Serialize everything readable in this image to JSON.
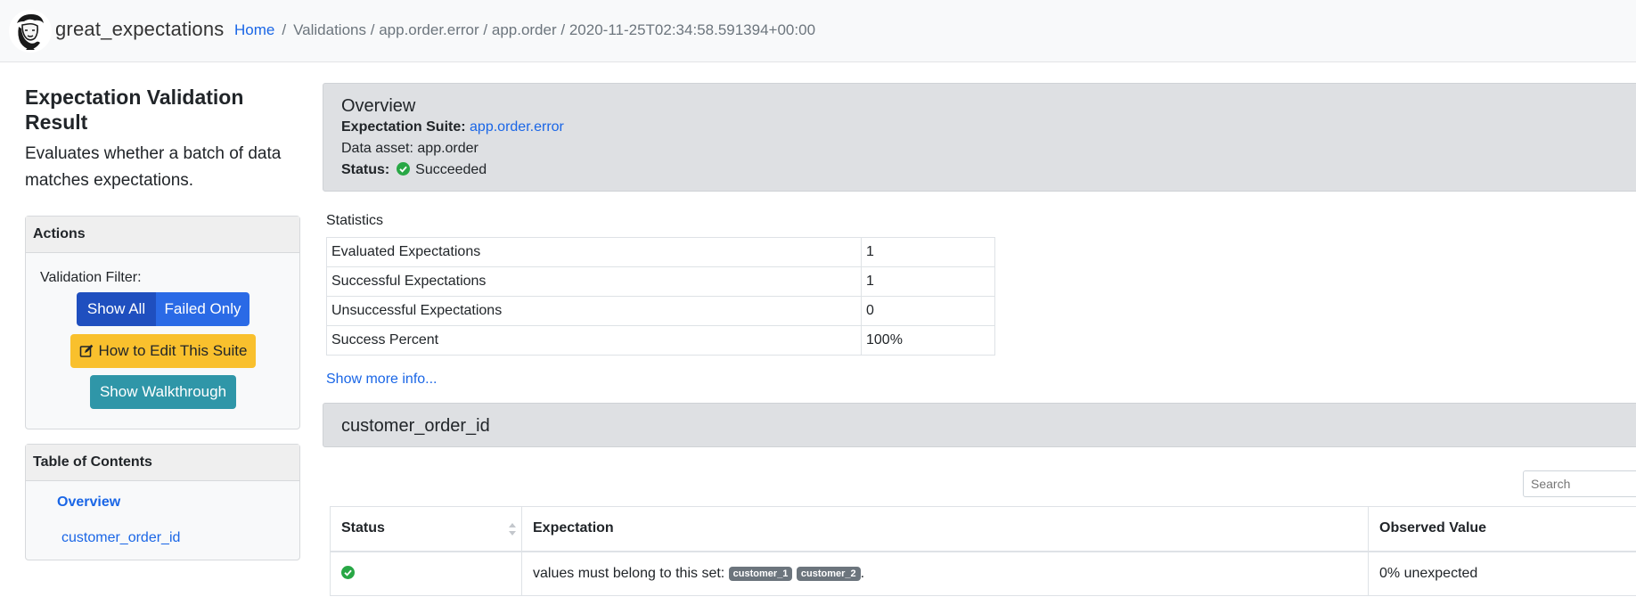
{
  "navbar": {
    "brand": "great_expectations",
    "breadcrumb": {
      "home": "Home",
      "sep": "/",
      "validations": "Validations",
      "suite": "app.order.error",
      "asset": "app.order",
      "run": "2020-11-25T02:34:58.591394+00:00"
    }
  },
  "sidebar": {
    "title": "Expectation Validation Result",
    "description": "Evaluates whether a batch of data matches expectations.",
    "actions": {
      "header": "Actions",
      "filter_label": "Validation Filter:",
      "show_all": "Show All",
      "failed_only": "Failed Only",
      "edit_suite": "How to Edit This Suite",
      "walkthrough": "Show Walkthrough"
    },
    "toc": {
      "header": "Table of Contents",
      "items": [
        "Overview",
        "customer_order_id"
      ]
    }
  },
  "overview": {
    "title": "Overview",
    "suite_label": "Expectation Suite:",
    "suite_value": "app.order.error",
    "asset_label": "Data asset:",
    "asset_value": "app.order",
    "status_label": "Status:",
    "status_value": "Succeeded",
    "status_color": "#28a745"
  },
  "statistics": {
    "title": "Statistics",
    "rows": [
      {
        "label": "Evaluated Expectations",
        "value": "1"
      },
      {
        "label": "Successful Expectations",
        "value": "1"
      },
      {
        "label": "Unsuccessful Expectations",
        "value": "0"
      },
      {
        "label": "Success Percent",
        "value": "100%"
      }
    ]
  },
  "show_more": "Show more info...",
  "column_section": {
    "title": "customer_order_id",
    "search_placeholder": "Search",
    "headers": {
      "status": "Status",
      "expectation": "Expectation",
      "observed": "Observed Value"
    },
    "rows": [
      {
        "status_icon": "success-check-icon",
        "expectation_text": "values must belong to this set: ",
        "badges": [
          "customer_1",
          "customer_2"
        ],
        "expectation_suffix": ".",
        "observed": "0% unexpected"
      }
    ]
  },
  "colors": {
    "link": "#1a66e6",
    "primary_dark": "#1f4fbf",
    "primary": "#2a6ae6",
    "warning": "#f9c02d",
    "info": "#2f96a8",
    "success": "#28a745"
  }
}
